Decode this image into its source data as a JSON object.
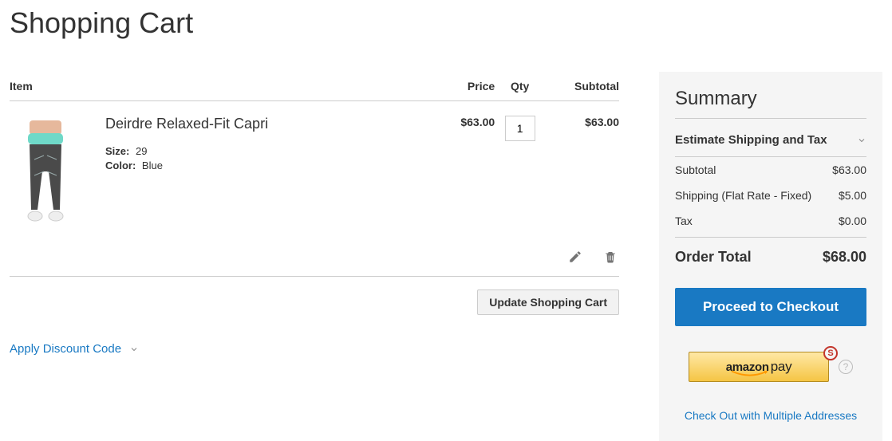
{
  "page_title": "Shopping Cart",
  "table": {
    "headers": {
      "item": "Item",
      "price": "Price",
      "qty": "Qty",
      "subtotal": "Subtotal"
    },
    "items": [
      {
        "name": "Deirdre Relaxed-Fit Capri",
        "options": [
          {
            "label": "Size:",
            "value": "29"
          },
          {
            "label": "Color:",
            "value": "Blue"
          }
        ],
        "price": "$63.00",
        "qty": "1",
        "subtotal": "$63.00"
      }
    ],
    "update_label": "Update Shopping Cart"
  },
  "discount": {
    "label": "Apply Discount Code"
  },
  "summary": {
    "title": "Summary",
    "estimate_label": "Estimate Shipping and Tax",
    "rows": [
      {
        "label": "Subtotal",
        "value": "$63.00"
      },
      {
        "label": "Shipping (Flat Rate - Fixed)",
        "value": "$5.00"
      },
      {
        "label": "Tax",
        "value": "$0.00"
      }
    ],
    "order_total": {
      "label": "Order Total",
      "value": "$68.00"
    },
    "checkout_label": "Proceed to Checkout",
    "amazon": {
      "brand": "amazon",
      "pay": "pay",
      "badge": "S"
    },
    "help": "?",
    "multi_address_label": "Check Out with Multiple Addresses"
  }
}
